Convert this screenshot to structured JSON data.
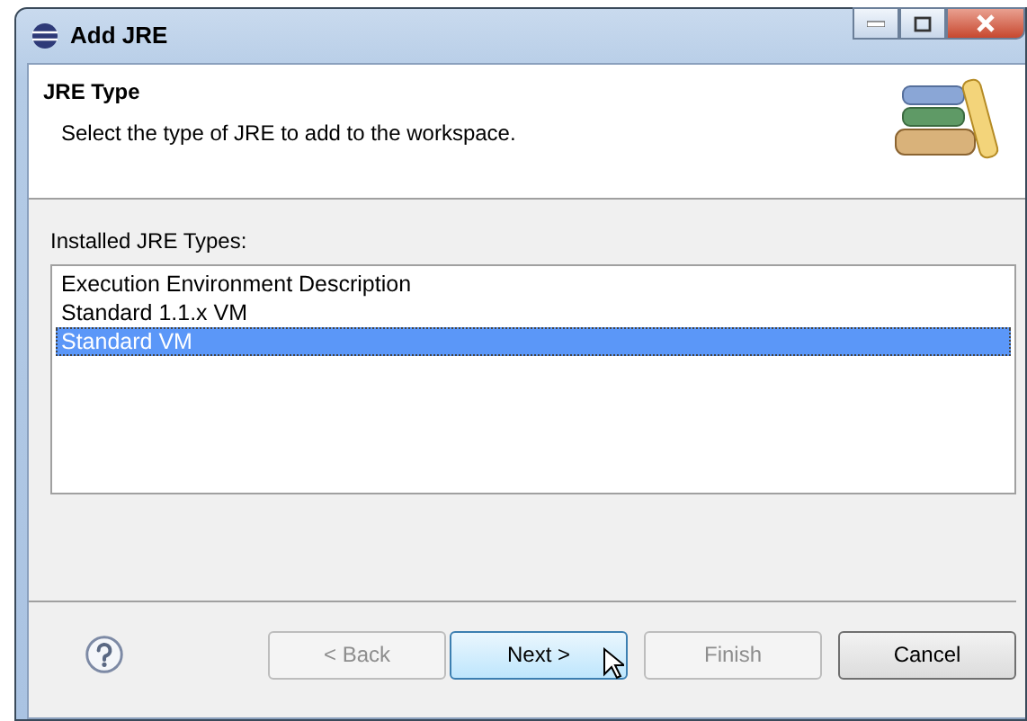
{
  "window": {
    "title": "Add JRE"
  },
  "header": {
    "title": "JRE Type",
    "description": "Select the type of JRE to add to the workspace."
  },
  "list": {
    "label": "Installed JRE Types:",
    "items": [
      {
        "label": "Execution Environment Description",
        "selected": false
      },
      {
        "label": "Standard 1.1.x VM",
        "selected": false
      },
      {
        "label": "Standard VM",
        "selected": true
      }
    ]
  },
  "buttons": [
    {
      "label": "< Back",
      "disabled": true,
      "default": false
    },
    {
      "label": "Next >",
      "disabled": false,
      "default": true
    },
    {
      "label": "Finish",
      "disabled": true,
      "default": false
    },
    {
      "label": "Cancel",
      "disabled": false,
      "default": false
    }
  ]
}
